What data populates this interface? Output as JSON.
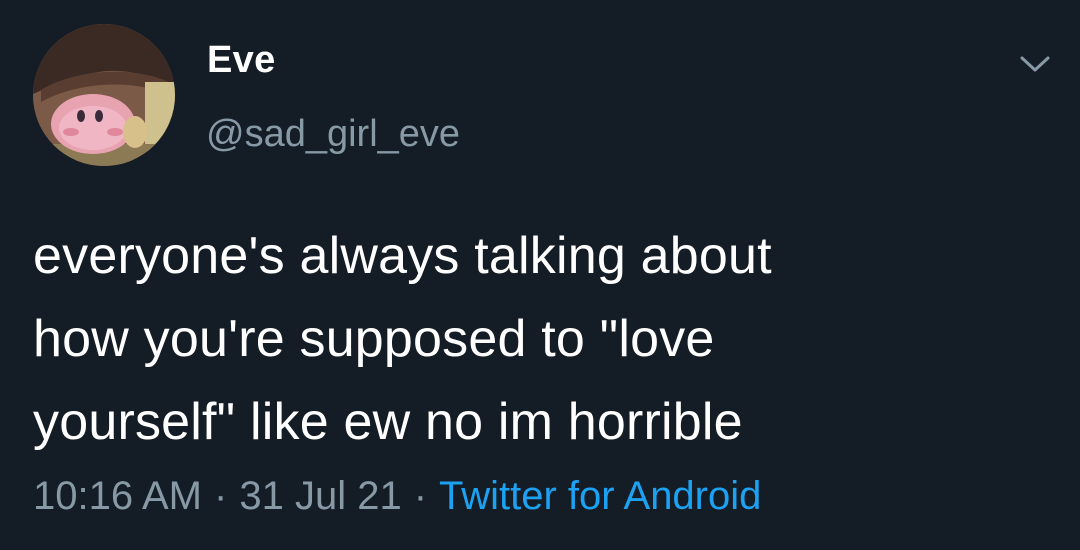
{
  "author": {
    "display_name": "Eve",
    "handle": "@sad_girl_eve",
    "avatar_icon": "kirby-avatar-icon"
  },
  "menu": {
    "icon": "chevron-down-icon"
  },
  "tweet": {
    "lines": [
      "everyone's always talking about",
      "how you're supposed to \"love",
      "yourself\" like ew no im horrible"
    ]
  },
  "meta": {
    "time": "10:16 AM",
    "separator": "·",
    "date": "31 Jul 21",
    "source": "Twitter for Android"
  },
  "colors": {
    "background": "#141d26",
    "text": "#ffffff",
    "secondary_text": "#8899a6",
    "link": "#1da1f2"
  }
}
